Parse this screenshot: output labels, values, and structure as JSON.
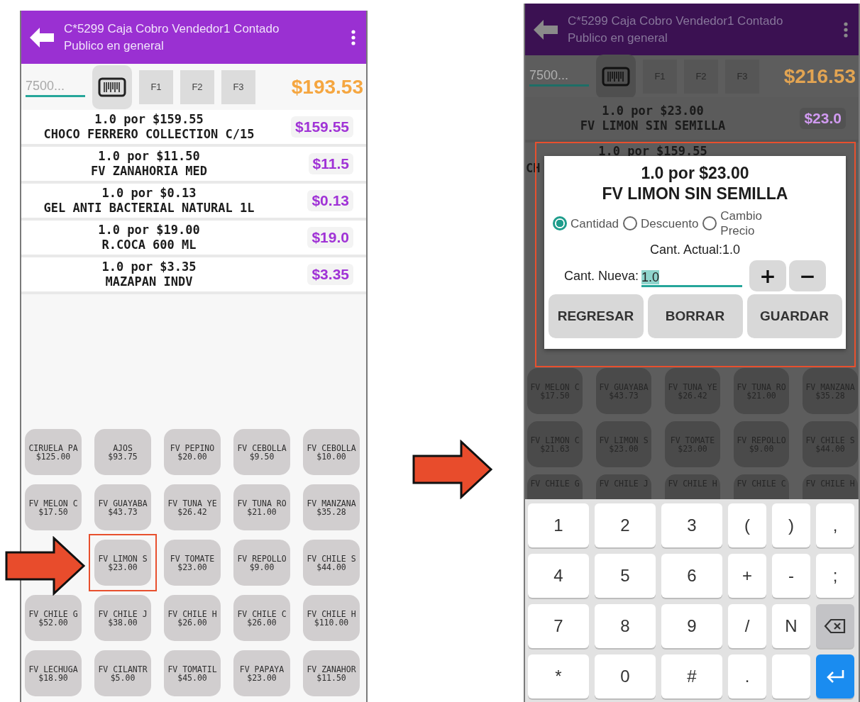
{
  "screens": [
    {
      "dimmed": false,
      "header": {
        "title": "C*5299 Caja Cobro Vendedor1 Contado",
        "subtitle": "Publico en general"
      },
      "toolbar": {
        "search": {
          "placeholder": "7500..."
        },
        "function_keys": [
          "F1",
          "F2",
          "F3"
        ],
        "total": "$193.53"
      },
      "items": [
        {
          "line1": "1.0 por $159.55",
          "line2": "CHOCO FERRERO COLLECTION C/15",
          "amount": "$159.55"
        },
        {
          "line1": "1.0 por $11.50",
          "line2": "FV ZANAHORIA MED",
          "amount": "$11.5"
        },
        {
          "line1": "1.0 por $0.13",
          "line2": "GEL ANTI BACTERIAL NATURAL 1L",
          "amount": "$0.13"
        },
        {
          "line1": "1.0 por $19.00",
          "line2": "R.COCA 600 ML",
          "amount": "$19.0"
        },
        {
          "line1": "1.0 por $3.35",
          "line2": "MAZAPAN INDV",
          "amount": "$3.35"
        }
      ],
      "product_grid": [
        [
          {
            "kind": "product",
            "name": "CIRUELA PA",
            "price": "$125.00",
            "highlighted": false
          },
          {
            "kind": "product",
            "name": "AJOS",
            "price": "$93.75",
            "highlighted": false
          },
          {
            "kind": "product",
            "name": "FV PEPINO",
            "price": "$20.00",
            "highlighted": false
          },
          {
            "kind": "product",
            "name": "FV CEBOLLA",
            "price": "$9.50",
            "highlighted": false
          },
          {
            "kind": "product",
            "name": "FV CEBOLLA",
            "price": "$10.00",
            "highlighted": false
          }
        ],
        [
          {
            "kind": "product",
            "name": "FV MELON C",
            "price": "$17.50",
            "highlighted": false
          },
          {
            "kind": "product",
            "name": "FV GUAYABA",
            "price": "$43.73",
            "highlighted": false
          },
          {
            "kind": "product",
            "name": "FV TUNA YE",
            "price": "$26.42",
            "highlighted": false
          },
          {
            "kind": "product",
            "name": "FV TUNA RO",
            "price": "$21.00",
            "highlighted": false
          },
          {
            "kind": "product",
            "name": "FV MANZANA",
            "price": "$35.28",
            "highlighted": false
          }
        ],
        [
          {
            "kind": "blank"
          },
          {
            "kind": "product",
            "name": "FV LIMON S",
            "price": "$23.00",
            "highlighted": true
          },
          {
            "kind": "product",
            "name": "FV TOMATE",
            "price": "$23.00",
            "highlighted": false
          },
          {
            "kind": "product",
            "name": "FV REPOLLO",
            "price": "$9.00",
            "highlighted": false
          },
          {
            "kind": "product",
            "name": "FV CHILE S",
            "price": "$44.00",
            "highlighted": false
          }
        ],
        [
          {
            "kind": "product",
            "name": "FV CHILE G",
            "price": "$52.00",
            "highlighted": false
          },
          {
            "kind": "product",
            "name": "FV CHILE J",
            "price": "$38.00",
            "highlighted": false
          },
          {
            "kind": "product",
            "name": "FV CHILE H",
            "price": "$26.00",
            "highlighted": false
          },
          {
            "kind": "product",
            "name": "FV CHILE C",
            "price": "$26.00",
            "highlighted": false
          },
          {
            "kind": "product",
            "name": "FV CHILE H",
            "price": "$110.00",
            "highlighted": false
          }
        ],
        [
          {
            "kind": "product",
            "name": "FV LECHUGA",
            "price": "$18.90",
            "highlighted": false
          },
          {
            "kind": "product",
            "name": "FV CILANTR",
            "price": "$5.00",
            "highlighted": false
          },
          {
            "kind": "product",
            "name": "FV TOMATIL",
            "price": "$45.00",
            "highlighted": false
          },
          {
            "kind": "product",
            "name": "FV PAPAYA",
            "price": "$23.00",
            "highlighted": false
          },
          {
            "kind": "product",
            "name": "FV ZANAHOR",
            "price": "$11.50",
            "highlighted": false
          }
        ]
      ]
    },
    {
      "dimmed": true,
      "header": {
        "title": "C*5299 Caja Cobro Vendedor1 Contado",
        "subtitle": "Publico en general"
      },
      "toolbar": {
        "search": {
          "placeholder": "7500..."
        },
        "function_keys": [
          "F1",
          "F2",
          "F3"
        ],
        "total": "$216.53"
      },
      "items": [
        {
          "line1": "1.0 por $23.00",
          "line2": "FV LIMON SIN SEMILLA",
          "amount": "$23.0"
        }
      ],
      "partial_item": {
        "line1": "1.0 por $159.55",
        "line2": "CH"
      },
      "product_grid": [
        [
          {
            "kind": "product",
            "name": "FV MELON C",
            "price": "$17.50"
          },
          {
            "kind": "product",
            "name": "FV GUAYABA",
            "price": "$43.73"
          },
          {
            "kind": "product",
            "name": "FV TUNA YE",
            "price": "$26.42"
          },
          {
            "kind": "product",
            "name": "FV TUNA RO",
            "price": "$21.00"
          },
          {
            "kind": "product",
            "name": "FV MANZANA",
            "price": "$35.28"
          }
        ],
        [
          {
            "kind": "product",
            "name": "FV LIMON C",
            "price": "$21.63"
          },
          {
            "kind": "product",
            "name": "FV LIMON S",
            "price": "$23.00"
          },
          {
            "kind": "product",
            "name": "FV TOMATE",
            "price": "$23.00"
          },
          {
            "kind": "product",
            "name": "FV REPOLLO",
            "price": "$9.00"
          },
          {
            "kind": "product",
            "name": "FV CHILE S",
            "price": "$44.00"
          }
        ],
        [
          {
            "kind": "product",
            "name": "FV CHILE G"
          },
          {
            "kind": "product",
            "name": "FV CHILE J"
          },
          {
            "kind": "product",
            "name": "FV CHILE H"
          },
          {
            "kind": "product",
            "name": "FV CHILE C"
          },
          {
            "kind": "product",
            "name": "FV CHILE H"
          }
        ]
      ],
      "dialog": {
        "title_line1": "1.0 por $23.00",
        "title_line2": "FV LIMON SIN SEMILLA",
        "options": [
          {
            "label": "Cantidad",
            "selected": true
          },
          {
            "label": "Descuento",
            "selected": false
          },
          {
            "label": "Cambio Precio",
            "selected": false
          }
        ],
        "current": "Cant. Actual:1.0",
        "new_label": "Cant. Nueva:",
        "new_value": "1.0",
        "stepper": [
          "+",
          "−"
        ],
        "buttons": [
          "REGRESAR",
          "BORRAR",
          "GUARDAR"
        ]
      },
      "keyboard": [
        [
          {
            "kind": "char",
            "label": "1"
          },
          {
            "kind": "char",
            "label": "2"
          },
          {
            "kind": "char",
            "label": "3"
          },
          {
            "kind": "char",
            "label": "("
          },
          {
            "kind": "char",
            "label": ")"
          },
          {
            "kind": "char",
            "label": ","
          }
        ],
        [
          {
            "kind": "char",
            "label": "4"
          },
          {
            "kind": "char",
            "label": "5"
          },
          {
            "kind": "char",
            "label": "6"
          },
          {
            "kind": "char",
            "label": "+"
          },
          {
            "kind": "char",
            "label": "-"
          },
          {
            "kind": "char",
            "label": ";"
          }
        ],
        [
          {
            "kind": "char",
            "label": "7"
          },
          {
            "kind": "char",
            "label": "8"
          },
          {
            "kind": "char",
            "label": "9"
          },
          {
            "kind": "char",
            "label": "/"
          },
          {
            "kind": "char",
            "label": "N"
          },
          {
            "kind": "backspace"
          }
        ],
        [
          {
            "kind": "char",
            "label": "*"
          },
          {
            "kind": "char",
            "label": "0"
          },
          {
            "kind": "char",
            "label": "#"
          },
          {
            "kind": "char",
            "label": "."
          },
          {
            "kind": "blank"
          },
          {
            "kind": "enter"
          }
        ]
      ]
    }
  ]
}
